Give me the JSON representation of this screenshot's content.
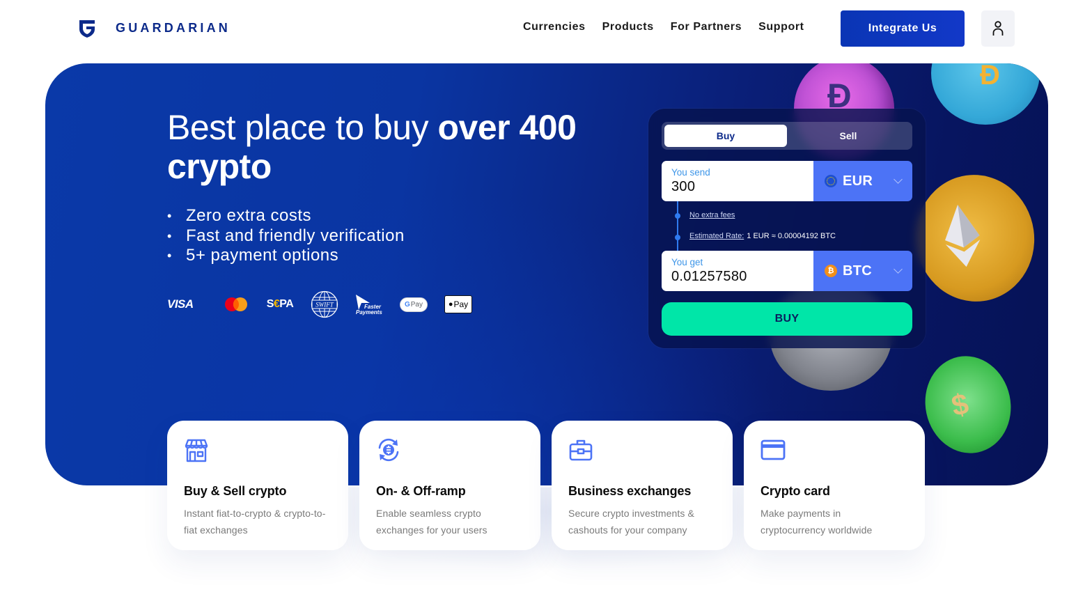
{
  "header": {
    "brand": "GUARDARIAN",
    "nav": [
      {
        "label": "Currencies"
      },
      {
        "label": "Products"
      },
      {
        "label": "For Partners"
      },
      {
        "label": "Support"
      }
    ],
    "cta_label": "Integrate Us",
    "account_icon": "user-icon"
  },
  "hero": {
    "title_regular": "Best place to buy ",
    "title_bold_1": "over 400",
    "title_bold_2": "crypto",
    "features": [
      "Zero extra costs",
      "Fast and friendly verification",
      "5+ payment options"
    ],
    "bullet": "•",
    "payment_methods": {
      "visa": "VISA",
      "mastercard": "mastercard-logo",
      "sepa_s": "S",
      "sepa_e": "€",
      "sepa_rest": "PA",
      "swift": "SWIFT",
      "faster_payments_1": "Faster",
      "faster_payments_2": "Payments",
      "google_pay_g": "G",
      "google_pay": "Pay",
      "apple_pay": "Pay",
      "apple_glyph": ""
    }
  },
  "widget": {
    "tabs": [
      {
        "label": "Buy",
        "active": true
      },
      {
        "label": "Sell",
        "active": false
      }
    ],
    "send": {
      "label": "You send",
      "value": "300",
      "currency": "EUR"
    },
    "fees_link": "No extra fees",
    "rate_label": "Estimated Rate:",
    "rate_value": "1 EUR ≈ 0.00004192 BTC",
    "get": {
      "label": "You get",
      "value": "0.01257580",
      "currency": "BTC",
      "currency_glyph": "₿"
    },
    "buy_label": "BUY"
  },
  "cards": [
    {
      "icon": "storefront-icon",
      "title": "Buy & Sell crypto",
      "desc": "Instant fiat-to-crypto & crypto-to-fiat exchanges"
    },
    {
      "icon": "crypto-exchange-icon",
      "title": "On- & Off-ramp",
      "desc": "Enable seamless crypto exchanges for your users"
    },
    {
      "icon": "briefcase-icon",
      "title": "Business exchanges",
      "desc": "Secure crypto investments & cashouts for your company"
    },
    {
      "icon": "credit-card-icon",
      "title": "Crypto card",
      "desc": "Make payments in cryptocurrency worldwide"
    }
  ],
  "colors": {
    "brand_blue": "#0c2a8a",
    "cta_blue": "#1238c8",
    "currency_select": "#4c73f6",
    "buy_button": "#00e6a8",
    "icon_blue": "#4c73f6"
  }
}
